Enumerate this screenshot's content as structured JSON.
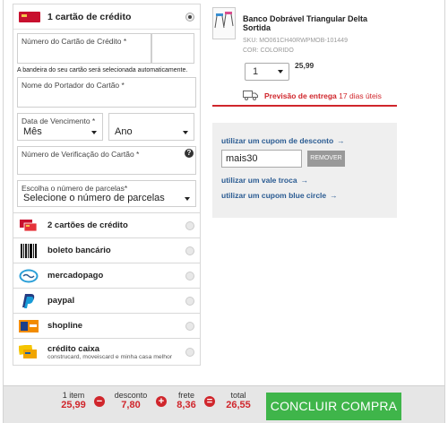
{
  "payment": {
    "credit_card": {
      "title": "1 cartão de crédito",
      "card_number_label": "Número do Cartão de Crédito *",
      "card_flag_hint": "A bandeira do seu cartão será selecionada automaticamente.",
      "holder_label": "Nome do Portador do Cartão *",
      "expiry_label": "Data de Vencimento *",
      "month_value": "Mês",
      "year_value": "Ano",
      "cvv_label": "Número de Verificação do Cartão *",
      "installments_label": "Escolha o número de parcelas*",
      "installments_value": "Selecione o número de parcelas"
    },
    "methods": [
      {
        "label": "2 cartões de crédito",
        "icon": "two-cards-icon"
      },
      {
        "label": "boleto bancário",
        "icon": "barcode-icon"
      },
      {
        "label": "mercadopago",
        "icon": "mercadopago-icon"
      },
      {
        "label": "paypal",
        "icon": "paypal-icon"
      },
      {
        "label": "shopline",
        "icon": "shopline-icon"
      },
      {
        "label": "crédito caixa",
        "sublabel": "construcard, moveiscard e minha casa melhor",
        "icon": "caixa-card-icon"
      }
    ]
  },
  "product": {
    "title": "Banco Dobrável Triangular Delta Sortida",
    "sku": "SKU: MO061CH40RWPMOB-101449",
    "color": "COR: COLORIDO",
    "quantity": "1",
    "price": "25,99",
    "delivery_label": "Previsão de entrega",
    "delivery_days": "17 dias úteis"
  },
  "coupon": {
    "link_coupon": "utilizar um cupom de desconto",
    "code": "mais30",
    "remove_label": "REMOVER",
    "link_voucher": "utilizar um vale troca",
    "link_blue_circle": "utilizar um cupom blue circle"
  },
  "summary": {
    "items_label": "1 item",
    "items_value": "25,99",
    "discount_label": "desconto",
    "discount_value": "7,80",
    "shipping_label": "frete",
    "shipping_value": "8,36",
    "total_label": "total",
    "total_value": "26,55",
    "minus": "−",
    "plus": "+",
    "equals": "=",
    "checkout_label": "CONCLUIR COMPRA"
  },
  "colors": {
    "accent_red": "#d0262c",
    "link_blue": "#2a5b92",
    "checkout_green": "#3fb54a"
  }
}
